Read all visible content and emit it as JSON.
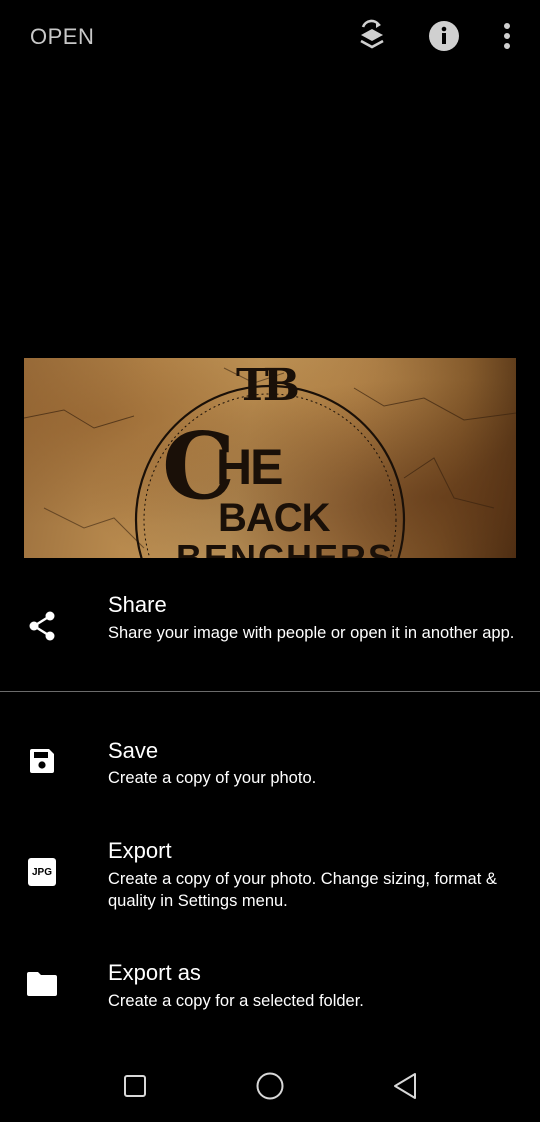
{
  "topbar": {
    "open_label": "OPEN",
    "icons": [
      "layers-swap-icon",
      "info-icon",
      "more-vert-icon"
    ]
  },
  "preview": {
    "logo_monogram": "TB",
    "logo_line1": "HE",
    "logo_line2": "BACK",
    "logo_line3": "BENCHERS"
  },
  "sheet": {
    "items": [
      {
        "title": "Share",
        "desc": "Share your image with people or open it in another app.",
        "icon": "share-icon"
      },
      {
        "title": "Save",
        "desc": "Create a copy of your photo.",
        "icon": "save-icon"
      },
      {
        "title": "Export",
        "desc": "Create a copy of your photo. Change sizing, format & quality in Settings menu.",
        "icon": "jpg-icon",
        "badge": "JPG"
      },
      {
        "title": "Export as",
        "desc": "Create a copy for a selected folder.",
        "icon": "folder-icon"
      }
    ]
  },
  "navbar": {
    "icons": [
      "recents-icon",
      "home-icon",
      "back-icon"
    ]
  },
  "colors": {
    "background": "#000000",
    "text": "#ffffff",
    "muted": "#c8c8c8",
    "divider": "#6b6b6b"
  }
}
